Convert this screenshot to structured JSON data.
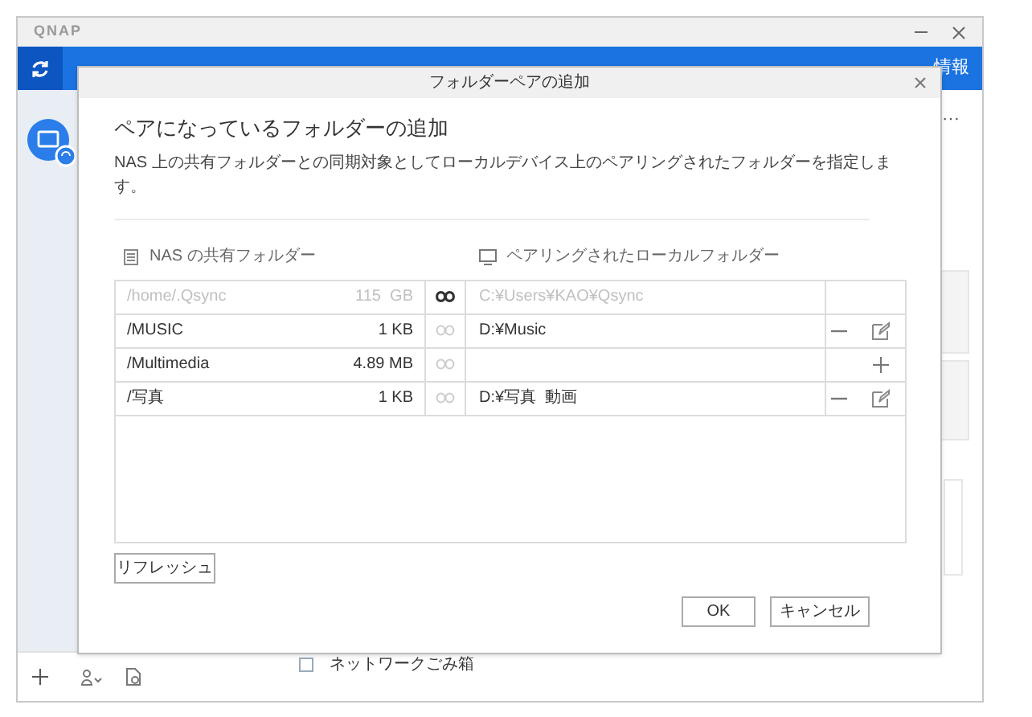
{
  "app": {
    "logo": "QNAP",
    "header_link": "情報",
    "more": "···",
    "trash_label": "ネットワークごみ箱",
    "trash_checked": false
  },
  "dialog": {
    "title": "フォルダーペアの追加",
    "heading": "ペアになっているフォルダーの追加",
    "description": "NAS 上の共有フォルダーとの同期対象としてローカルデバイス上のペアリングされたフォルダーを指定します。",
    "nas_column": "NAS の共有フォルダー",
    "local_column": "ペアリングされたローカルフォルダー",
    "rows": [
      {
        "name": "/home/.Qsync",
        "size": "115  GB",
        "local": "C:¥Users¥KAO¥Qsync",
        "disabled": true,
        "linked": true,
        "actions": []
      },
      {
        "name": "/MUSIC",
        "size": "1 KB",
        "local": "D:¥Music",
        "disabled": false,
        "linked": false,
        "actions": [
          {
            "kind": "remove"
          },
          {
            "kind": "edit"
          }
        ]
      },
      {
        "name": "/Multimedia",
        "size": "4.89 MB",
        "local": "",
        "disabled": false,
        "linked": false,
        "actions": [
          {
            "kind": "add"
          }
        ]
      },
      {
        "name": "/写真",
        "size": "1 KB",
        "local": "D:¥写真  動画",
        "disabled": false,
        "linked": false,
        "actions": [
          {
            "kind": "remove"
          },
          {
            "kind": "edit"
          }
        ]
      }
    ],
    "refresh_button": "リフレッシュ",
    "buttons": [
      "OK",
      "キャンセル"
    ]
  }
}
